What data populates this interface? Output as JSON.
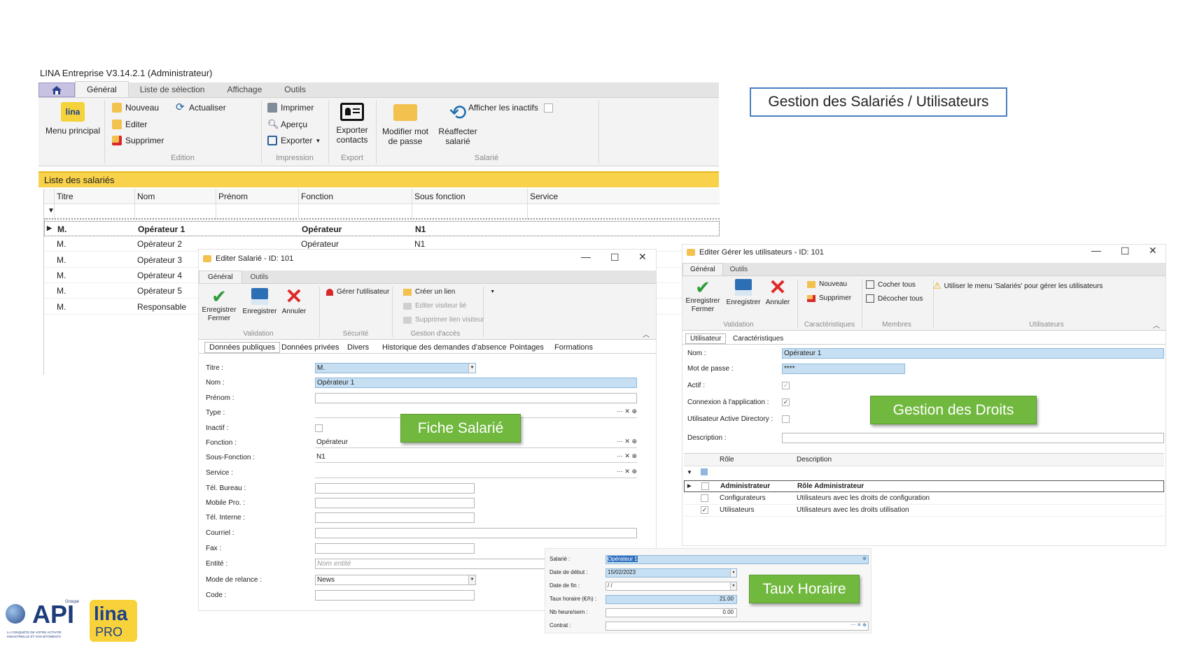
{
  "title_bar": {
    "text": "LINA Entreprise  V3.14.2.1  (Administrateur)"
  },
  "main_ribbon": {
    "tabs": [
      "Général",
      "Liste de sélection",
      "Affichage",
      "Outils"
    ],
    "menu_principal": "Menu principal",
    "edition": {
      "nouveau": "Nouveau",
      "actualiser": "Actualiser",
      "editer": "Editer",
      "supprimer": "Supprimer",
      "label": "Edition"
    },
    "impression": {
      "imprimer": "Imprimer",
      "apercu": "Aperçu",
      "exporter": "Exporter",
      "label": "Impression"
    },
    "export": {
      "exporter_contacts": "Exporter contacts",
      "label": "Export"
    },
    "salarie": {
      "modifier_mot": "Modifier mot de passe",
      "reaffecter": "Réaffecter salarié",
      "label": "Salarié"
    },
    "afficher_inactifs": "Afficher les inactifs"
  },
  "list": {
    "title": "Liste des salariés",
    "columns": [
      "Titre",
      "Nom",
      "Prénom",
      "Fonction",
      "Sous fonction",
      "Service"
    ],
    "rows": [
      {
        "titre": "M.",
        "nom": "Opérateur 1",
        "prenom": "",
        "fonction": "Opérateur",
        "sous": "N1",
        "service": ""
      },
      {
        "titre": "M.",
        "nom": "Opérateur 2",
        "prenom": "",
        "fonction": "Opérateur",
        "sous": "N1",
        "service": ""
      },
      {
        "titre": "M.",
        "nom": "Opérateur 3",
        "prenom": "",
        "fonction": "",
        "sous": "",
        "service": ""
      },
      {
        "titre": "M.",
        "nom": "Opérateur 4",
        "prenom": "",
        "fonction": "",
        "sous": "",
        "service": ""
      },
      {
        "titre": "M.",
        "nom": "Opérateur 5",
        "prenom": "",
        "fonction": "",
        "sous": "",
        "service": ""
      },
      {
        "titre": "M.",
        "nom": "Responsable",
        "prenom": "",
        "fonction": "",
        "sous": "",
        "service": ""
      }
    ]
  },
  "callout_title": "Gestion des Salariés / Utilisateurs",
  "salarie_win": {
    "title": "Editer Salarié - ID: 101",
    "tabs": [
      "Général",
      "Outils"
    ],
    "btn_enreg_fermer": "Enregistrer Fermer",
    "btn_enregistrer": "Enregistrer",
    "btn_annuler": "Annuler",
    "gerer_utilisateur": "Gérer l'utilisateur",
    "creer_lien": "Créer un lien",
    "editer_visiteur": "Editer visiteur lié",
    "supprimer_lien": "Supprimer lien visiteur",
    "grp_validation": "Validation",
    "grp_securite": "Sécurité",
    "grp_acces": "Gestion d'accès",
    "subtabs": [
      "Données publiques",
      "Données privées",
      "Divers",
      "Historique des demandes d'absence",
      "Pointages",
      "Formations"
    ],
    "labels": [
      "Titre :",
      "Nom :",
      "Prénom :",
      "Type :",
      "Inactif :",
      "Fonction :",
      "Sous-Fonction :",
      "Service :",
      "Tél. Bureau :",
      "Mobile Pro. :",
      "Tél. Interne :",
      "Courriel :",
      "Fax :",
      "Entité :",
      "Mode de relance :",
      "Code :"
    ],
    "titre_val": "M.",
    "nom_val": "Opérateur 1",
    "fonction_val": "Opérateur",
    "sous_fonction_val": "N1",
    "entite_placeholder": "Nom entité",
    "relance_val": "News"
  },
  "tag_fiche": "Fiche Salarié",
  "users_win": {
    "title": "Editer Gérer les utilisateurs - ID: 101",
    "tabs": [
      "Général",
      "Outils"
    ],
    "btn_enreg_fermer": "Enregistrer Fermer",
    "btn_enregistrer": "Enregistrer",
    "btn_annuler": "Annuler",
    "nouveau": "Nouveau",
    "supprimer": "Supprimer",
    "cocher": "Cocher tous",
    "decocher": "Décocher tous",
    "warning": "Utiliser le menu 'Salariés' pour gérer les utilisateurs",
    "grp_validation": "Validation",
    "grp_caract": "Caractéristiques",
    "grp_membres": "Membres",
    "grp_users": "Utilisateurs",
    "subtabs": [
      "Utilisateur",
      "Caractéristiques"
    ],
    "labels": [
      "Nom :",
      "Mot de passe :",
      "Actif :",
      "Connexion à l'application :",
      "Utilisateur Active Directory :",
      "Description :"
    ],
    "nom_val": "Opérateur 1",
    "pwd_val": "****",
    "role_cols": [
      "Rôle",
      "Description"
    ],
    "roles": [
      {
        "role": "Administrateur",
        "desc": "Rôle Administrateur",
        "checked": false
      },
      {
        "role": "Configurateurs",
        "desc": "Utilisateurs avec les droits de configuration",
        "checked": false
      },
      {
        "role": "Utilisateurs",
        "desc": "Utilisateurs avec les droits utilisation",
        "checked": true
      }
    ]
  },
  "tag_droits": "Gestion des Droits",
  "taux": {
    "labels": [
      "Salarié :",
      "Date de début :",
      "Date de fin :",
      "Taux horaire (€/h) :",
      "Nb heure/sem :",
      "Contrat :"
    ],
    "salarie_val": "Opérateur 1",
    "date_debut": "15/02/2023",
    "date_fin": "  /  /",
    "taux_val": "21.00",
    "nb_val": "0.00"
  },
  "tag_taux": "Taux Horaire",
  "logo": {
    "api": "API",
    "groupe": "Groupe",
    "tagline": "LA CONQUÊTE DE VOTRE ACTIVITÉ INDUSTRIELLE ET VOS BÂTIMENTS",
    "lina": "lina",
    "pro": "PRO"
  }
}
